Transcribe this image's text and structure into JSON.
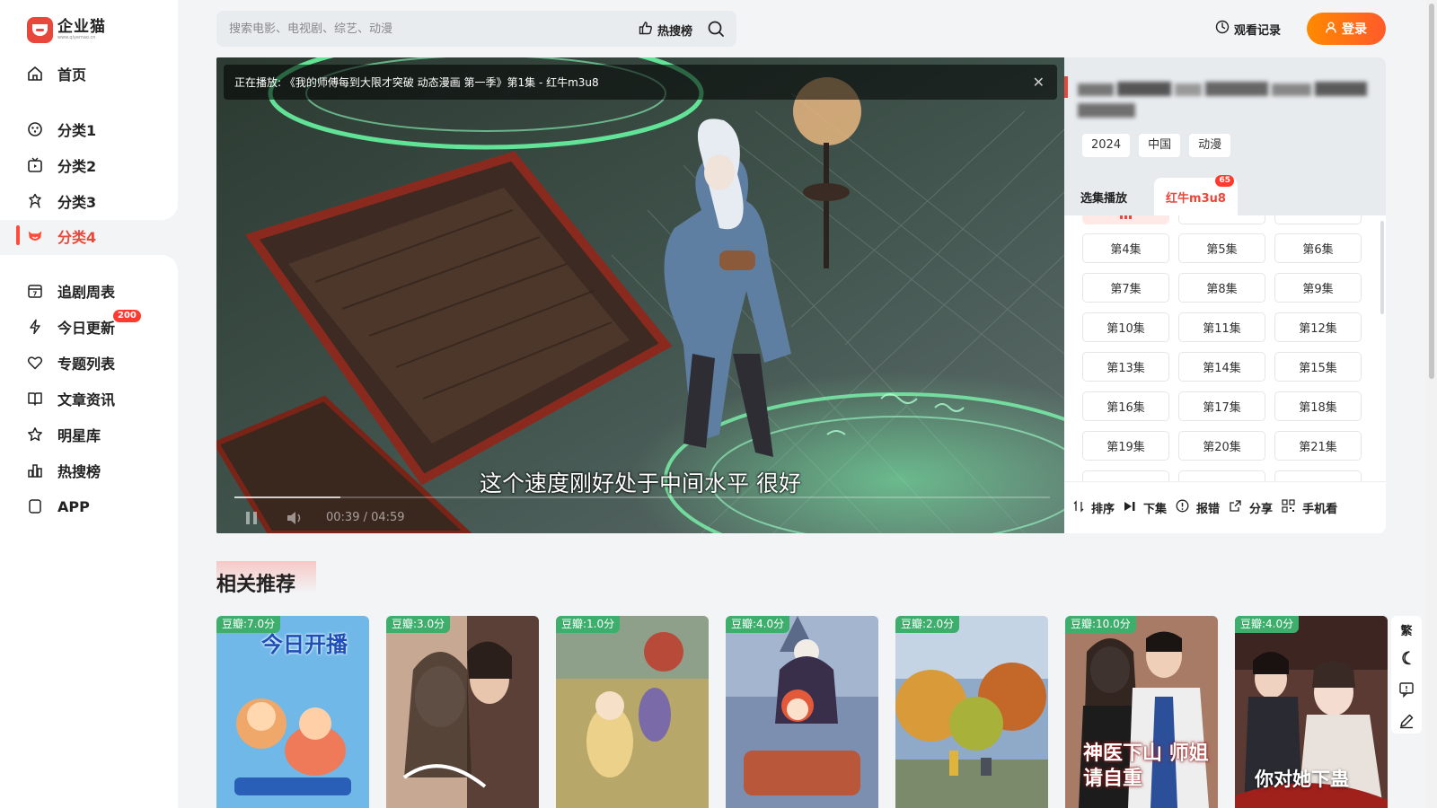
{
  "brand": {
    "name": "企业猫",
    "subtitle": "www.qiyemao.cn"
  },
  "sidebar": {
    "items": [
      {
        "label": "首页",
        "icon": "home-icon"
      },
      {
        "label": "分类1",
        "icon": "category-icon"
      },
      {
        "label": "分类2",
        "icon": "tv-icon"
      },
      {
        "label": "分类3",
        "icon": "badge-icon"
      },
      {
        "label": "分类4",
        "icon": "anime-icon",
        "active": true
      },
      {
        "label": "追剧周表",
        "icon": "calendar-icon"
      },
      {
        "label": "今日更新",
        "icon": "lightning-icon",
        "badge": "200"
      },
      {
        "label": "专题列表",
        "icon": "heart-icon"
      },
      {
        "label": "文章资讯",
        "icon": "book-icon"
      },
      {
        "label": "明星库",
        "icon": "star-icon"
      },
      {
        "label": "热搜榜",
        "icon": "bar-chart-icon"
      },
      {
        "label": "APP",
        "icon": "phone-icon"
      }
    ]
  },
  "header": {
    "search_placeholder": "搜索电影、电视剧、综艺、动漫",
    "hot_label": "热搜榜",
    "history_label": "观看记录",
    "login_label": "登录"
  },
  "player": {
    "now_playing": "正在播放: 《我的师傅每到大限才突破 动态漫画 第一季》第1集 - 红牛m3u8",
    "subtitle": "这个速度刚好处于中间水平 很好",
    "time": "00:39 / 04:59",
    "progress": 0.13
  },
  "detail": {
    "tags": [
      "2024",
      "中国",
      "动漫"
    ],
    "tab_episodes": "选集播放",
    "tab_source": "红牛m3u8",
    "source_count": "65",
    "episodes": [
      "第4集",
      "第5集",
      "第6集",
      "第7集",
      "第8集",
      "第9集",
      "第10集",
      "第11集",
      "第12集",
      "第13集",
      "第14集",
      "第15集",
      "第16集",
      "第17集",
      "第18集",
      "第19集",
      "第20集",
      "第21集"
    ],
    "footer": {
      "sort": "排序",
      "next": "下集",
      "report": "报错",
      "share": "分享",
      "mobile": "手机看"
    }
  },
  "related": {
    "title": "相关推荐",
    "cards": [
      {
        "score": "豆瓣:7.0分",
        "poster_text": "今日开播",
        "bg": "#6fb8e8"
      },
      {
        "score": "豆瓣:3.0分",
        "poster_text": "",
        "bg": "#c7a892"
      },
      {
        "score": "豆瓣:1.0分",
        "poster_text": "",
        "bg": "#b7a86a"
      },
      {
        "score": "豆瓣:4.0分",
        "poster_text": "",
        "bg": "#7d8fb0"
      },
      {
        "score": "豆瓣:2.0分",
        "poster_text": "",
        "bg": "#8fa9c8"
      },
      {
        "score": "豆瓣:10.0分",
        "poster_text": "神医下山 师姐请自重",
        "bg": "#a87b67"
      },
      {
        "score": "豆瓣:4.0分",
        "poster_text": "你对她下蛊",
        "bg": "#5b3a33"
      }
    ]
  },
  "tools": {
    "traditional": "繁"
  },
  "colors": {
    "accent": "#e8473b",
    "login_start": "#ff8a00",
    "login_end": "#ff5a2a",
    "score_green": "#3dae6b"
  }
}
